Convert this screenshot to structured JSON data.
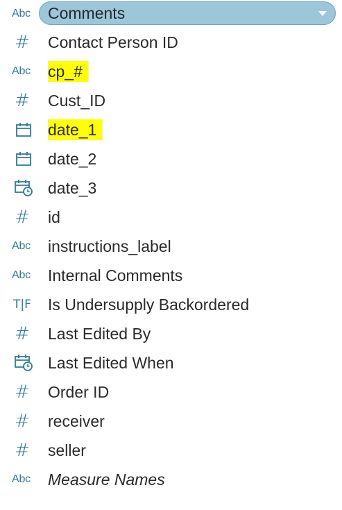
{
  "colors": {
    "icon": "#2b7b9a",
    "selected_bg": "#9dc6d8",
    "highlight": "#ffff00",
    "text": "#2a2a2a"
  },
  "fields": [
    {
      "type_label": "Abc",
      "type": "string",
      "name": "Comments",
      "selected": true
    },
    {
      "type_label": "#",
      "type": "number",
      "name": "Contact Person ID"
    },
    {
      "type_label": "Abc",
      "type": "string",
      "name": "cp_#",
      "highlighted": true
    },
    {
      "type_label": "#",
      "type": "number",
      "name": "Cust_ID"
    },
    {
      "type": "date",
      "icon": "calendar-icon",
      "name": "date_1",
      "highlighted": true
    },
    {
      "type": "date",
      "icon": "calendar-icon",
      "name": "date_2"
    },
    {
      "type": "datetime",
      "icon": "calendar-clock-icon",
      "name": "date_3"
    },
    {
      "type_label": "#",
      "type": "number",
      "name": "id"
    },
    {
      "type_label": "Abc",
      "type": "string",
      "name": "instructions_label"
    },
    {
      "type_label": "Abc",
      "type": "string",
      "name": "Internal Comments"
    },
    {
      "type_label": "T|F",
      "type": "boolean",
      "name": "Is Undersupply Backordered"
    },
    {
      "type_label": "#",
      "type": "number",
      "name": "Last Edited By"
    },
    {
      "type": "datetime",
      "icon": "calendar-clock-icon",
      "name": "Last Edited When"
    },
    {
      "type_label": "#",
      "type": "number",
      "name": "Order ID"
    },
    {
      "type_label": "#",
      "type": "number",
      "name": "receiver"
    },
    {
      "type_label": "#",
      "type": "number",
      "name": "seller"
    },
    {
      "type_label": "Abc",
      "type": "string",
      "name": "Measure Names",
      "italic": true
    }
  ]
}
